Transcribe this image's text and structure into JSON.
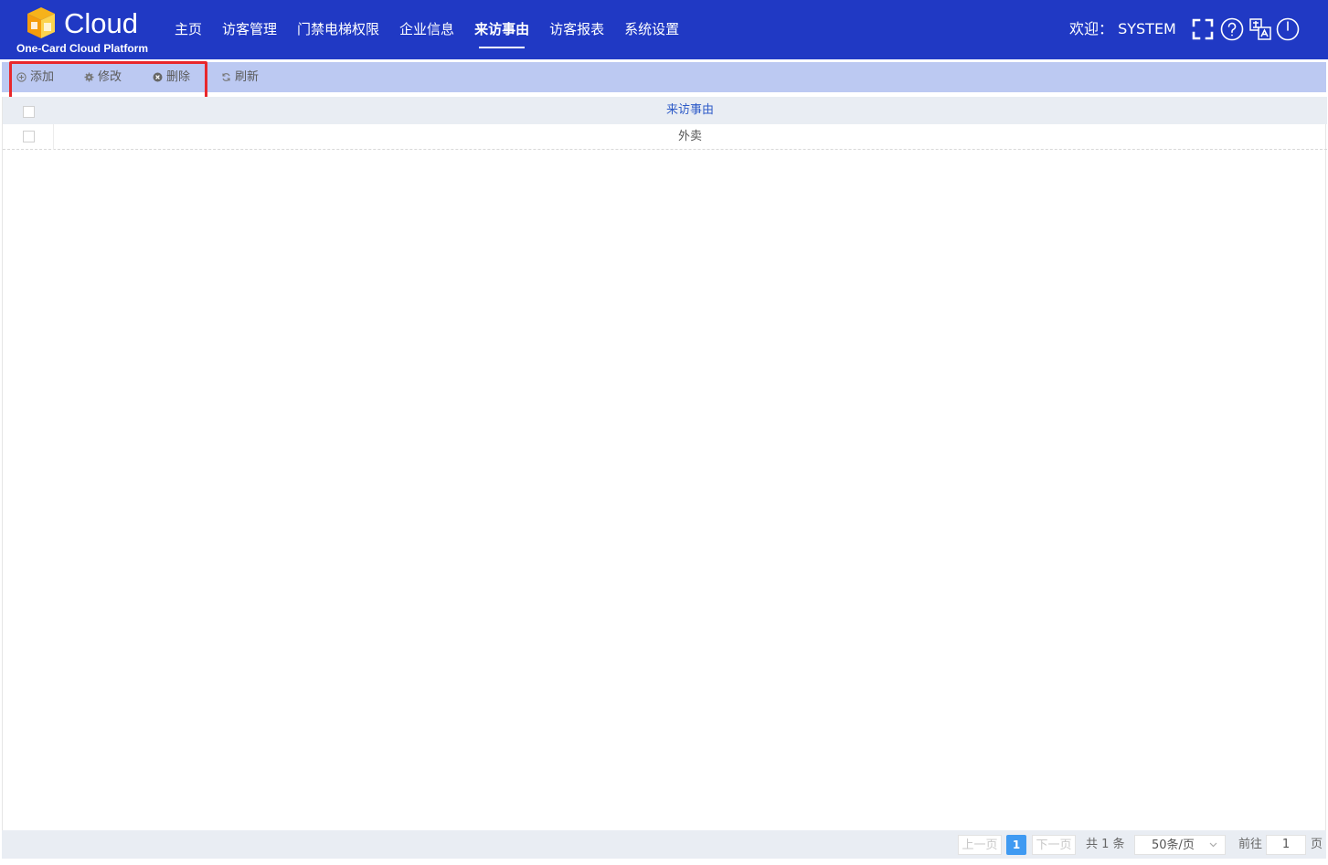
{
  "logo": {
    "brand": "Cloud",
    "subtitle": "One-Card Cloud Platform"
  },
  "nav": {
    "items": [
      {
        "label": "主页"
      },
      {
        "label": "访客管理"
      },
      {
        "label": "门禁电梯权限"
      },
      {
        "label": "企业信息"
      },
      {
        "label": "来访事由",
        "active": true
      },
      {
        "label": "访客报表"
      },
      {
        "label": "系统设置"
      }
    ]
  },
  "header": {
    "welcome": "欢迎： SYSTEM",
    "icons": [
      "fullscreen-icon",
      "help-icon",
      "language-icon",
      "power-icon"
    ]
  },
  "toolbar": {
    "add_label": "添加",
    "edit_label": "修改",
    "delete_label": "删除",
    "refresh_label": "刷新"
  },
  "table": {
    "columns": [
      "来访事由"
    ],
    "rows": [
      [
        "外卖"
      ]
    ]
  },
  "pager": {
    "prev_label": "上一页",
    "current_page": "1",
    "next_label": "下一页",
    "total_text": "共 1 条",
    "page_size": "50条/页",
    "goto_label": "前往",
    "goto_value": "1",
    "page_suffix": "页"
  },
  "colors": {
    "header_bg": "#2039c4",
    "toolbar_bg": "#bcc9f2",
    "highlight_border": "#e8272c",
    "column_header_text": "#2f5cc8",
    "current_page_bg": "#3f9af2"
  }
}
